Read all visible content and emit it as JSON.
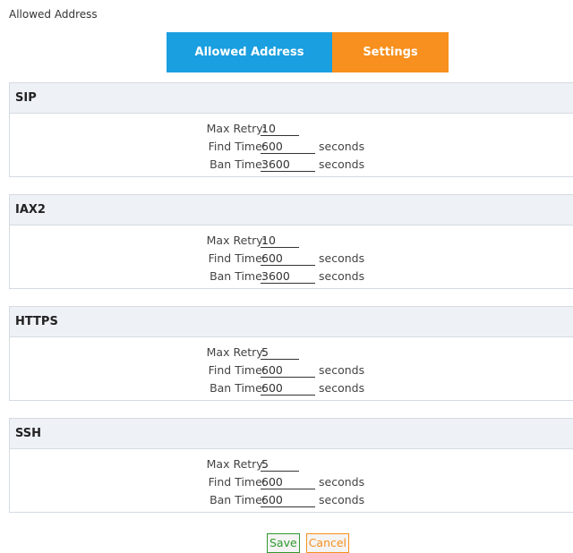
{
  "page": {
    "title": "Allowed Address"
  },
  "tabs": [
    {
      "label": "Allowed Address",
      "active": false,
      "color": "#1a9fe0"
    },
    {
      "label": "Settings",
      "active": true,
      "color": "#f7901e"
    }
  ],
  "labels": {
    "max_retry": "Max Retry:",
    "find_time": "Find Time:",
    "ban_time": "Ban Time:",
    "unit": "seconds"
  },
  "sections": [
    {
      "title": "SIP",
      "max_retry": "10",
      "find_time": "600",
      "ban_time": "3600"
    },
    {
      "title": "IAX2",
      "max_retry": "10",
      "find_time": "600",
      "ban_time": "3600"
    },
    {
      "title": "HTTPS",
      "max_retry": "5",
      "find_time": "600",
      "ban_time": "600"
    },
    {
      "title": "SSH",
      "max_retry": "5",
      "find_time": "600",
      "ban_time": "600"
    }
  ],
  "buttons": {
    "save": "Save",
    "cancel": "Cancel"
  },
  "colors": {
    "save": "#2e9a2e",
    "cancel": "#f7901e",
    "header_bg": "#eef2f7"
  }
}
